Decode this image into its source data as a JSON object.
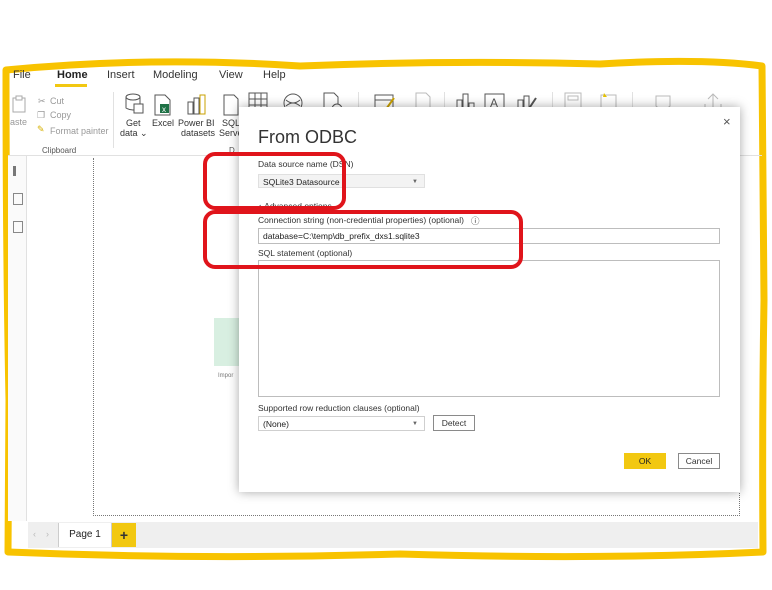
{
  "ribbon": {
    "tabs": [
      "File",
      "Home",
      "Insert",
      "Modeling",
      "View",
      "Help"
    ],
    "clipboard": {
      "paste": "aste",
      "cut": "Cut",
      "copy": "Copy",
      "format_painter": "Format painter",
      "group": "Clipboard"
    },
    "buttons": {
      "get_data": "Get",
      "get_data2": "data ⌄",
      "excel": "Excel",
      "power_bi": "Power BI",
      "power_bi2": "datasets",
      "sql": "SQL",
      "sql2": "Serve"
    },
    "data_group_fragment": "D"
  },
  "canvas": {
    "card_text": "Impor"
  },
  "pages": {
    "page1": "Page 1",
    "add": "+",
    "prev": "‹",
    "next": "›"
  },
  "dialog": {
    "title": "From ODBC",
    "close": "×",
    "dsn_label": "Data source name (DSN)",
    "dsn_value": "SQLite3 Datasource",
    "advanced_options": "▴ Advanced options",
    "conn_label": "Connection string (non-credential properties) (optional)",
    "info_icon": "ⓘ",
    "conn_value": "database=C:\\temp\\db_prefix_dxs1.sqlite3",
    "sql_label": "SQL statement (optional)",
    "rowred_label": "Supported row reduction clauses (optional)",
    "rowred_value": "(None)",
    "detect": "Detect",
    "ok": "OK",
    "cancel": "Cancel"
  },
  "colors": {
    "accent": "#f2c811",
    "highlight": "#e0141b",
    "frame": "#f8c300"
  }
}
